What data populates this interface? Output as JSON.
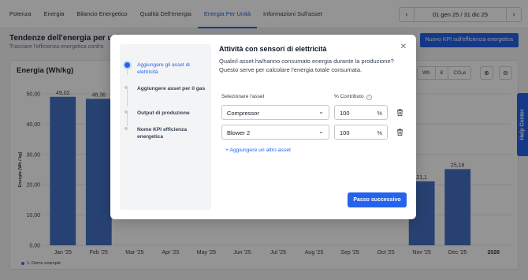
{
  "nav": {
    "tabs": [
      "Potenza",
      "Energia",
      "Bilancio Energetico",
      "Qualità Dell'energia",
      "Energia Per Unità",
      "Informazioni Sull'asset"
    ],
    "active_tab": "Energia Per Unità",
    "date_range": "01 gen 25 / 31 dic 25",
    "prev_icon": "chevron-left-icon",
    "next_icon": "chevron-right-icon"
  },
  "header": {
    "title": "Tendenze dell'energia per unit",
    "subtitle": "Tracciare l'efficienza energetica confro",
    "new_kpi_label": "Nuovo KPI sull'efficienza energetica"
  },
  "chart_card": {
    "title": "Energia (Wh/kg)",
    "unit_options": [
      "Wh",
      "€",
      "CO₂e"
    ],
    "zoom_in_icon": "zoom-in-icon",
    "zoom_out_icon": "zoom-out-icon"
  },
  "chart_data": {
    "type": "bar",
    "ylabel": "Energia (Wh / kg)",
    "ylim": [
      0,
      50
    ],
    "yticks": [
      "0,00",
      "10,00",
      "20,00",
      "30,00",
      "40,00",
      "50,00"
    ],
    "categories": [
      "Jan '25",
      "Feb '25",
      "Mar '25",
      "Apr '25",
      "May '25",
      "Jun '25",
      "Jul '25",
      "Aug '25",
      "Sep '25",
      "Oct '25",
      "Nov '25",
      "Dec '25",
      "2026"
    ],
    "series": [
      {
        "name": "1. Demo example",
        "values": [
          49.02,
          48.36,
          null,
          null,
          null,
          null,
          null,
          null,
          null,
          null,
          21.1,
          25.16,
          null
        ],
        "labels": [
          "49,02",
          "48,36",
          "",
          "",
          "",
          "",
          "",
          "",
          "",
          "",
          "21,1",
          "25,16",
          ""
        ]
      }
    ],
    "bar_color": "#4472c4",
    "grid": true,
    "legend_position": "bottom-left"
  },
  "help": {
    "label": "Help Center"
  },
  "modal": {
    "steps": [
      {
        "label": "Aggiungere gli asset di elettricità",
        "active": true
      },
      {
        "label": "Aggiungere asset per il gas",
        "active": false
      },
      {
        "label": "Output di produzione",
        "active": false
      },
      {
        "label": "Nome KPI efficienza energetica",
        "active": false
      }
    ],
    "title": "Attività con sensori di elettricità",
    "description": "Quale/i asset ha/hanno consumato energia durante la produzione? Questo serve per calcolare l'energia totale consumata.",
    "col_asset": "Selezionare l'asset",
    "col_contrib": "% Contributo",
    "rows": [
      {
        "asset": "Compressor",
        "contribution": "100",
        "unit": "%"
      },
      {
        "asset": "Blower 2",
        "contribution": "100",
        "unit": "%"
      }
    ],
    "add_asset": "+ Aggiungere un altro asset",
    "next_label": "Passo successivo",
    "close_icon": "close-icon"
  }
}
